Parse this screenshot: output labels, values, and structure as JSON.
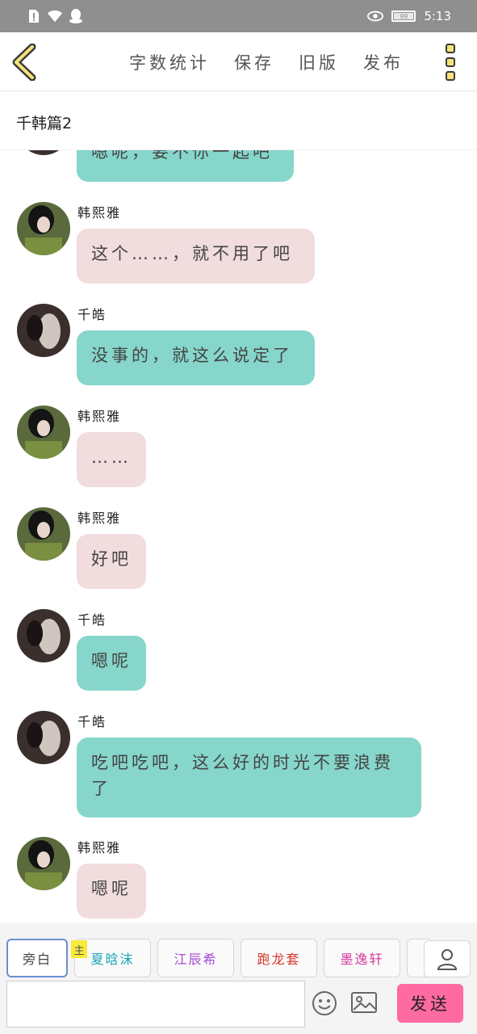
{
  "status_bar": {
    "time": "5:13",
    "battery": "99",
    "icons": [
      "alert-icon",
      "wifi-icon",
      "qq-icon",
      "eye-icon",
      "battery-icon"
    ]
  },
  "toolbar": {
    "word_count": "字数统计",
    "save": "保存",
    "old_version": "旧版",
    "publish": "发布"
  },
  "article": {
    "title": "千韩篇2"
  },
  "messages": [
    {
      "sender": "",
      "text": "嗯呢，要不你一起吧",
      "style": "teal"
    },
    {
      "sender": "韩熙雅",
      "text": "这个……，就不用了吧",
      "style": "pink"
    },
    {
      "sender": "千皓",
      "text": "没事的，就这么说定了",
      "style": "teal"
    },
    {
      "sender": "韩熙雅",
      "text": "……",
      "style": "pink"
    },
    {
      "sender": "韩熙雅",
      "text": "好吧",
      "style": "pink"
    },
    {
      "sender": "千皓",
      "text": "嗯呢",
      "style": "teal"
    },
    {
      "sender": "千皓",
      "text": "吃吧吃吧，这么好的时光不要浪费了",
      "style": "teal"
    },
    {
      "sender": "韩熙雅",
      "text": "嗯呢",
      "style": "pink"
    }
  ],
  "roles": [
    {
      "name": "旁白",
      "color": "#555555"
    },
    {
      "name": "夏晗沫",
      "color": "#1aa7b8"
    },
    {
      "name": "江辰希",
      "color": "#a64bd6"
    },
    {
      "name": "跑龙套",
      "color": "#d6352b"
    },
    {
      "name": "墨逸轩",
      "color": "#d63aa0"
    }
  ],
  "main_badge": "主",
  "input": {
    "placeholder": "",
    "value": ""
  },
  "send_label": "发送",
  "colors": {
    "teal_bubble": "#86d6cb",
    "pink_bubble": "#f1dcde",
    "send": "#ff6aa2",
    "status": "#8f8f8f"
  }
}
